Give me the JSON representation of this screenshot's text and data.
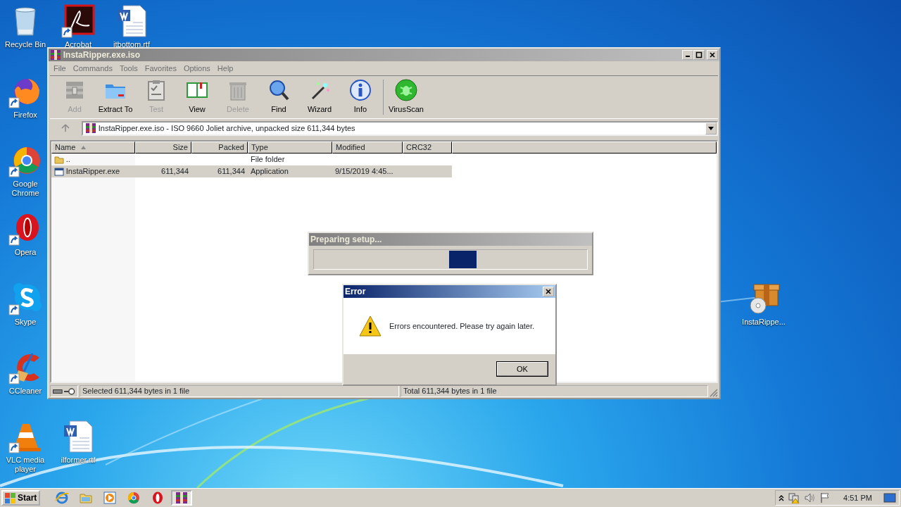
{
  "desktop_icons": [
    {
      "label": "Recycle Bin",
      "kind": "recycle",
      "shortcut": false
    },
    {
      "label": "Acrobat",
      "kind": "acrobat",
      "shortcut": true
    },
    {
      "label": "itbottom.rtf",
      "kind": "word",
      "shortcut": false
    },
    {
      "label": "Firefox",
      "kind": "firefox",
      "shortcut": true
    },
    {
      "label": "Google Chrome",
      "kind": "chrome",
      "shortcut": true
    },
    {
      "label": "Opera",
      "kind": "opera",
      "shortcut": true
    },
    {
      "label": "Skype",
      "kind": "skype",
      "shortcut": true
    },
    {
      "label": "CCleaner",
      "kind": "ccleaner",
      "shortcut": true
    },
    {
      "label": "VLC media player",
      "kind": "vlc",
      "shortcut": true
    },
    {
      "label": "ilformer.rtf",
      "kind": "word",
      "shortcut": false
    },
    {
      "label": "InstaRippe...",
      "kind": "package",
      "shortcut": false
    }
  ],
  "archiver_window": {
    "title": "InstaRipper.exe.iso",
    "menu": [
      "File",
      "Commands",
      "Tools",
      "Favorites",
      "Options",
      "Help"
    ],
    "toolbar": [
      {
        "label": "Add",
        "kind": "add",
        "disabled": true
      },
      {
        "label": "Extract To",
        "kind": "extract",
        "disabled": false
      },
      {
        "label": "Test",
        "kind": "test",
        "disabled": true
      },
      {
        "label": "View",
        "kind": "view",
        "disabled": false
      },
      {
        "label": "Delete",
        "kind": "delete",
        "disabled": true
      },
      {
        "label": "Find",
        "kind": "find",
        "disabled": false
      },
      {
        "label": "Wizard",
        "kind": "wizard",
        "disabled": false
      },
      {
        "label": "Info",
        "kind": "info",
        "disabled": false
      },
      {
        "label": "VirusScan",
        "kind": "virus",
        "disabled": false
      }
    ],
    "address": "InstaRipper.exe.iso - ISO 9660 Joliet archive, unpacked size 611,344 bytes",
    "columns": [
      {
        "label": "Name",
        "sorted": true
      },
      {
        "label": "Size",
        "sorted": false
      },
      {
        "label": "Packed",
        "sorted": false
      },
      {
        "label": "Type",
        "sorted": false
      },
      {
        "label": "Modified",
        "sorted": false
      },
      {
        "label": "CRC32",
        "sorted": false
      }
    ],
    "rows": [
      {
        "kind": "folder",
        "name": "..",
        "type": "File folder",
        "selected": false
      },
      {
        "kind": "exe",
        "name": "InstaRipper.exe",
        "size": "611,344",
        "packed": "611,344",
        "type": "Application",
        "modified": "9/15/2019 4:45...",
        "selected": true
      }
    ],
    "status_left": "Selected 611,344 bytes in 1 file",
    "status_right": "Total 611,344 bytes in 1 file"
  },
  "progress_dialog": {
    "title": "Preparing setup..."
  },
  "error_dialog": {
    "title": "Error",
    "message": "Errors encountered. Please try again later.",
    "button": "OK"
  },
  "taskbar": {
    "start": "Start",
    "apps": [
      {
        "kind": "ie",
        "active": false
      },
      {
        "kind": "explorer",
        "active": false
      },
      {
        "kind": "media",
        "active": false
      },
      {
        "kind": "chrome",
        "active": false
      },
      {
        "kind": "opera",
        "active": false
      },
      {
        "kind": "winrar",
        "active": true
      }
    ],
    "clock": "4:51 PM"
  }
}
